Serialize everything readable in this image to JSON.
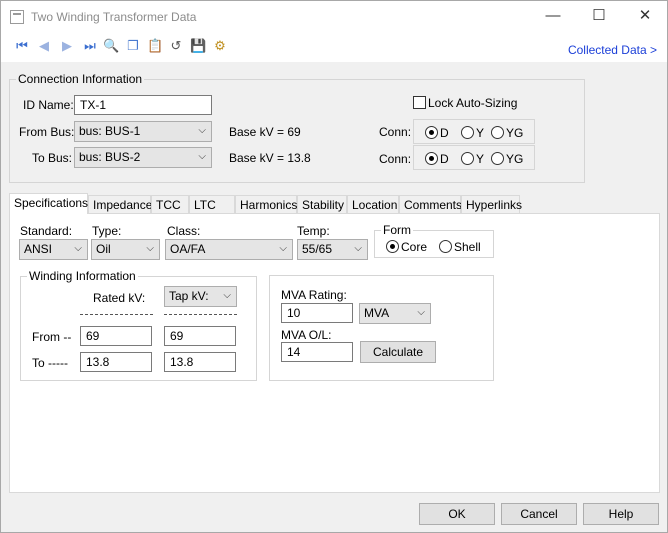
{
  "window": {
    "title": "Two Winding Transformer Data",
    "minimize": "—",
    "maximize": "☐",
    "close": "✕"
  },
  "toolbar": {
    "collected_data": "Collected Data >"
  },
  "connection": {
    "group_label": "Connection Information",
    "id_label": "ID Name:",
    "id_value": "TX-1",
    "from_bus_label": "From Bus:",
    "from_bus_value": "bus: BUS-1",
    "to_bus_label": "To Bus:",
    "to_bus_value": "bus: BUS-2",
    "from_basekv": "Base kV =  69",
    "to_basekv": "Base kV =  13.8",
    "lock_label": "Lock Auto-Sizing",
    "conn_label": "Conn:",
    "conn_options": [
      "D",
      "Y",
      "YG"
    ]
  },
  "tabs": [
    "Specifications",
    "Impedance",
    "TCC",
    "LTC",
    "Harmonics",
    "Stability",
    "Location",
    "Comments",
    "Hyperlinks"
  ],
  "spec": {
    "standard_label": "Standard:",
    "standard_value": "ANSI",
    "type_label": "Type:",
    "type_value": "Oil",
    "class_label": "Class:",
    "class_value": "OA/FA",
    "temp_label": "Temp:",
    "temp_value": "55/65",
    "form_label": "Form",
    "form_core": "Core",
    "form_shell": "Shell",
    "winding_label": "Winding Information",
    "rated_kv_label": "Rated kV:",
    "tap_kv_value": "Tap kV:",
    "from_label": "From --",
    "to_label": "To -----",
    "from_rated": "69",
    "from_tap": "69",
    "to_rated": "13.8",
    "to_tap": "13.8",
    "mva_rating_label": "MVA Rating:",
    "mva_rating_value": "10",
    "mva_unit": "MVA",
    "mva_ol_label": "MVA O/L:",
    "mva_ol_value": "14",
    "calculate": "Calculate"
  },
  "buttons": {
    "ok": "OK",
    "cancel": "Cancel",
    "help": "Help"
  }
}
